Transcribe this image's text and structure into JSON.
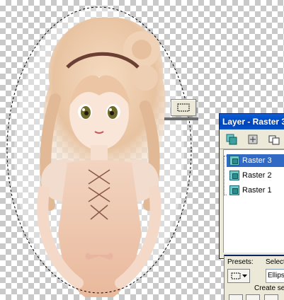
{
  "layer_palette": {
    "title": "Layer - Raster 3",
    "layers": [
      {
        "name": "Raster 3",
        "selected": true
      },
      {
        "name": "Raster 2",
        "selected": false
      },
      {
        "name": "Raster 1",
        "selected": false
      }
    ]
  },
  "tool_options": {
    "presets_label": "Presets:",
    "selection_label": "Selecti",
    "shape_value": "Ellips",
    "create_label": "Create sel"
  },
  "icons": {
    "mini_tool": "rectangle-selection-icon",
    "new_layer": "new-raster-layer-icon",
    "layer_tool_2": "layer-properties-icon",
    "layer_tool_3": "duplicate-layer-icon"
  },
  "colors": {
    "title_bar": "#0a5fd6",
    "selection_highlight": "#316ac5",
    "panel_bg": "#ece9d8"
  }
}
